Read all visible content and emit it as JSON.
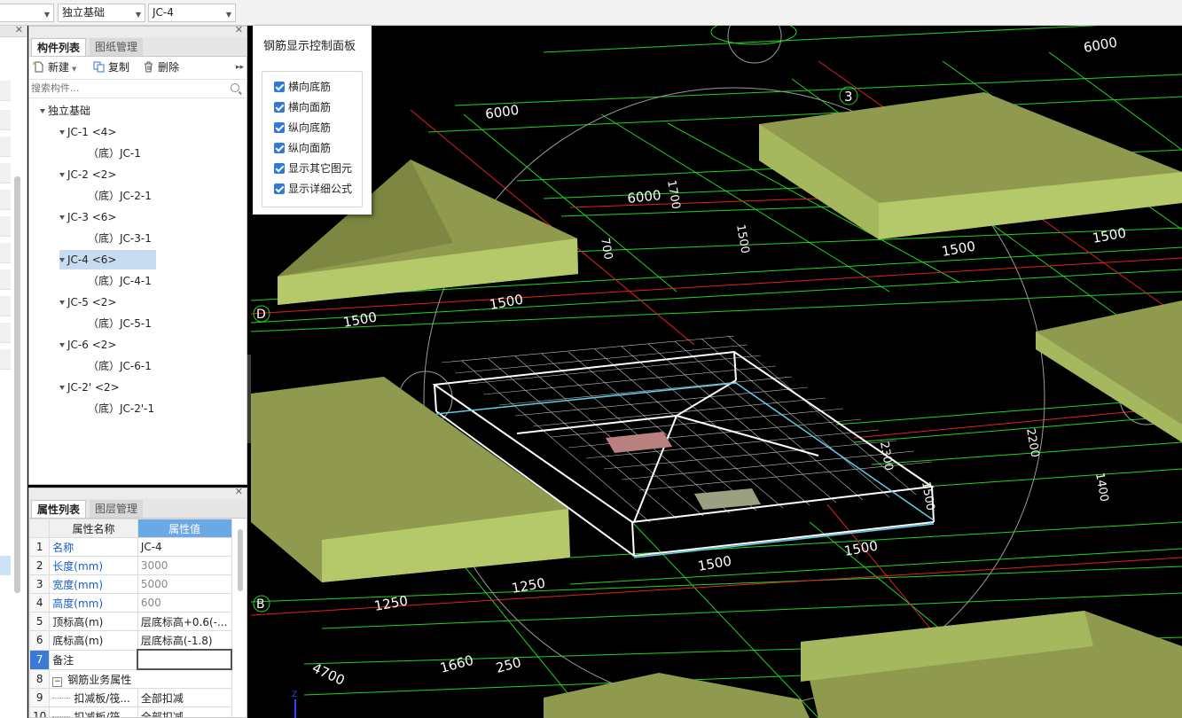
{
  "top_bar": {
    "combo1_value": "",
    "combo2_value": "独立基础",
    "combo3_value": "JC-4"
  },
  "component_panel": {
    "tabs": [
      "构件列表",
      "图纸管理"
    ],
    "toolbar": {
      "new": "新建",
      "copy": "复制",
      "delete": "删除"
    },
    "search_placeholder": "搜索构件...",
    "tree": [
      {
        "label": "独立基础",
        "level": 0
      },
      {
        "label": "JC-1 <4>",
        "level": 1
      },
      {
        "label": "（底）JC-1",
        "level": 2
      },
      {
        "label": "JC-2 <2>",
        "level": 1
      },
      {
        "label": "（底）JC-2-1",
        "level": 2
      },
      {
        "label": "JC-3 <6>",
        "level": 1
      },
      {
        "label": "（底）JC-3-1",
        "level": 2
      },
      {
        "label": "JC-4 <6>",
        "level": 1,
        "selected": true
      },
      {
        "label": "（底）JC-4-1",
        "level": 2
      },
      {
        "label": "JC-5 <2>",
        "level": 1
      },
      {
        "label": "（底）JC-5-1",
        "level": 2
      },
      {
        "label": "JC-6 <2>",
        "level": 1
      },
      {
        "label": "（底）JC-6-1",
        "level": 2
      },
      {
        "label": "JC-2' <2>",
        "level": 1
      },
      {
        "label": "（底）JC-2'-1",
        "level": 2
      }
    ]
  },
  "property_panel": {
    "tabs": [
      "属性列表",
      "图层管理"
    ],
    "col_name": "属性名称",
    "col_value": "属性值",
    "rows": [
      {
        "num": "1",
        "name": "名称",
        "value": "JC-4"
      },
      {
        "num": "2",
        "name": "长度(mm)",
        "value": "3000"
      },
      {
        "num": "3",
        "name": "宽度(mm)",
        "value": "5000"
      },
      {
        "num": "4",
        "name": "高度(mm)",
        "value": "600"
      },
      {
        "num": "5",
        "name": "顶标高(m)",
        "value": "层底标高+0.6(-..."
      },
      {
        "num": "6",
        "name": "底标高(m)",
        "value": "层底标高(-1.8)"
      },
      {
        "num": "7",
        "name": "备注",
        "value": ""
      },
      {
        "num": "8",
        "name": "钢筋业务属性",
        "value": ""
      },
      {
        "num": "9",
        "name": "扣减板/筏...",
        "value": "全部扣减"
      },
      {
        "num": "10",
        "name": "扣减板/筏...",
        "value": "全部扣减"
      }
    ]
  },
  "control_panel": {
    "title": "钢筋显示控制面板",
    "options": [
      {
        "label": "横向底筋",
        "checked": true
      },
      {
        "label": "横向面筋",
        "checked": true
      },
      {
        "label": "纵向底筋",
        "checked": true
      },
      {
        "label": "纵向面筋",
        "checked": true
      },
      {
        "label": "显示其它图元",
        "checked": true
      },
      {
        "label": "显示详细公式",
        "checked": true
      }
    ]
  },
  "viewport": {
    "dim_labels": [
      "6000",
      "6000",
      "6000",
      "1500",
      "1500",
      "1500",
      "1500",
      "1500",
      "1500",
      "1250",
      "1250",
      "1660",
      "250",
      "4700",
      "1700",
      "2200",
      "1500",
      "1400",
      "700",
      "2300",
      "1500"
    ],
    "axis_labels": [
      "D",
      "B",
      "3"
    ],
    "colors": {
      "footing": "#8f9a4f",
      "footing_light": "#b6c96a",
      "grid_green": "#19e619",
      "grid_red": "#e02020",
      "background": "#000000"
    }
  }
}
